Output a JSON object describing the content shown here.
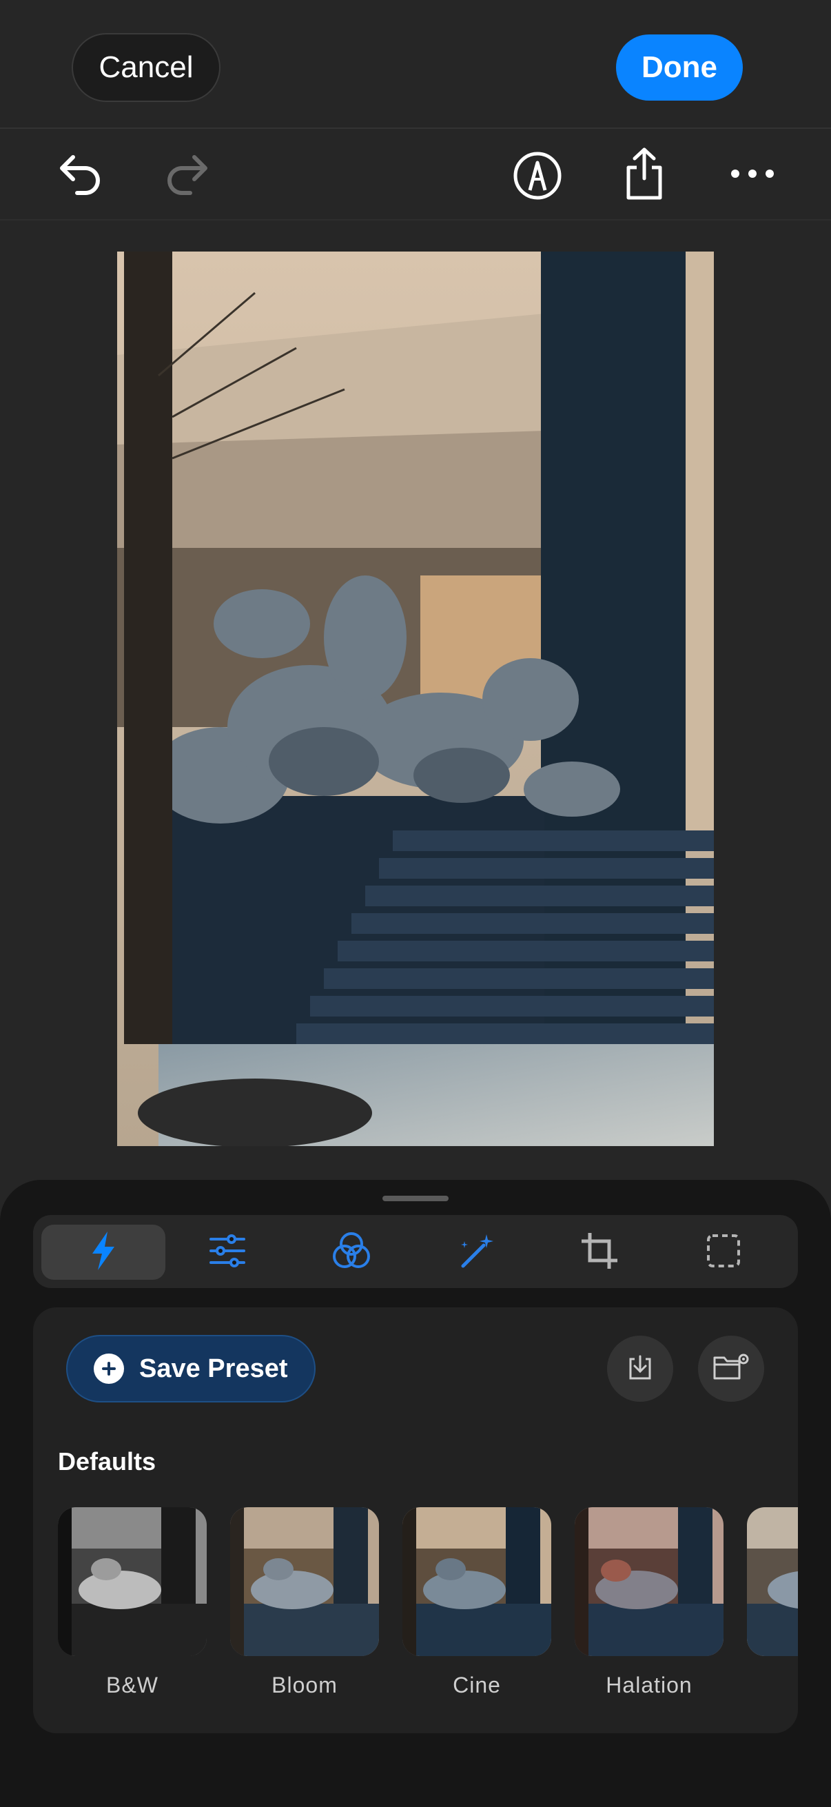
{
  "header": {
    "cancel_label": "Cancel",
    "done_label": "Done"
  },
  "toolbar": {
    "icons": [
      "undo-icon",
      "redo-icon",
      "markup-icon",
      "share-icon",
      "more-icon"
    ]
  },
  "tabs": [
    {
      "icon": "lightning-icon",
      "active": true
    },
    {
      "icon": "sliders-icon",
      "active": false
    },
    {
      "icon": "color-circles-icon",
      "active": false
    },
    {
      "icon": "magic-wand-icon",
      "active": false
    },
    {
      "icon": "crop-icon",
      "active": false
    },
    {
      "icon": "selection-icon",
      "active": false
    }
  ],
  "presets_panel": {
    "save_label": "Save Preset",
    "section_title": "Defaults",
    "items": [
      {
        "label": "B&W"
      },
      {
        "label": "Bloom"
      },
      {
        "label": "Cine"
      },
      {
        "label": "Halation"
      }
    ]
  },
  "colors": {
    "accent": "#0a84ff",
    "save_bg": "#14365f",
    "tab_icon_blue": "#2a7fe8"
  }
}
